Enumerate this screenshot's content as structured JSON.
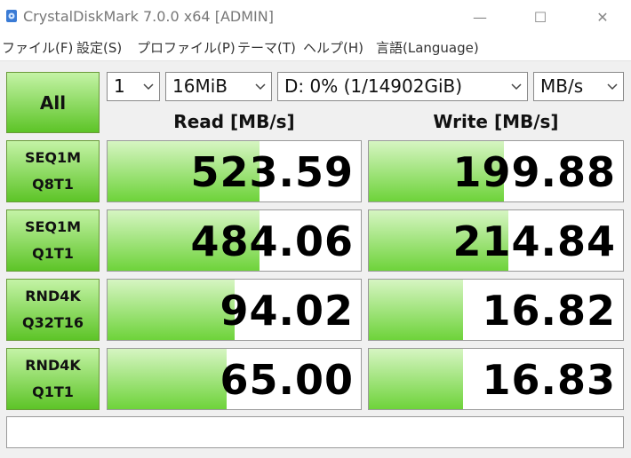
{
  "window": {
    "title": "CrystalDiskMark 7.0.0 x64 [ADMIN]"
  },
  "window_controls": {
    "minimize": "—",
    "maximize": "☐",
    "close": "✕"
  },
  "menu": [
    "ファイル(F)",
    "設定(S)",
    "プロファイル(P)",
    "テーマ(T)",
    "ヘルプ(H)",
    "言語(Language)"
  ],
  "controls": {
    "all_label": "All",
    "count": "1",
    "size": "16MiB",
    "drive": "D: 0% (1/14902GiB)",
    "unit": "MB/s"
  },
  "headers": {
    "read": "Read [MB/s]",
    "write": "Write [MB/s]"
  },
  "tests": [
    {
      "line1": "SEQ1M",
      "line2": "Q8T1",
      "read": "523.59",
      "write": "199.88",
      "read_fill": 0.6,
      "write_fill": 0.53
    },
    {
      "line1": "SEQ1M",
      "line2": "Q1T1",
      "read": "484.06",
      "write": "214.84",
      "read_fill": 0.6,
      "write_fill": 0.55
    },
    {
      "line1": "RND4K",
      "line2": "Q32T16",
      "read": "94.02",
      "write": "16.82",
      "read_fill": 0.5,
      "write_fill": 0.37
    },
    {
      "line1": "RND4K",
      "line2": "Q1T1",
      "read": "65.00",
      "write": "16.83",
      "read_fill": 0.47,
      "write_fill": 0.37
    }
  ],
  "comment": ""
}
